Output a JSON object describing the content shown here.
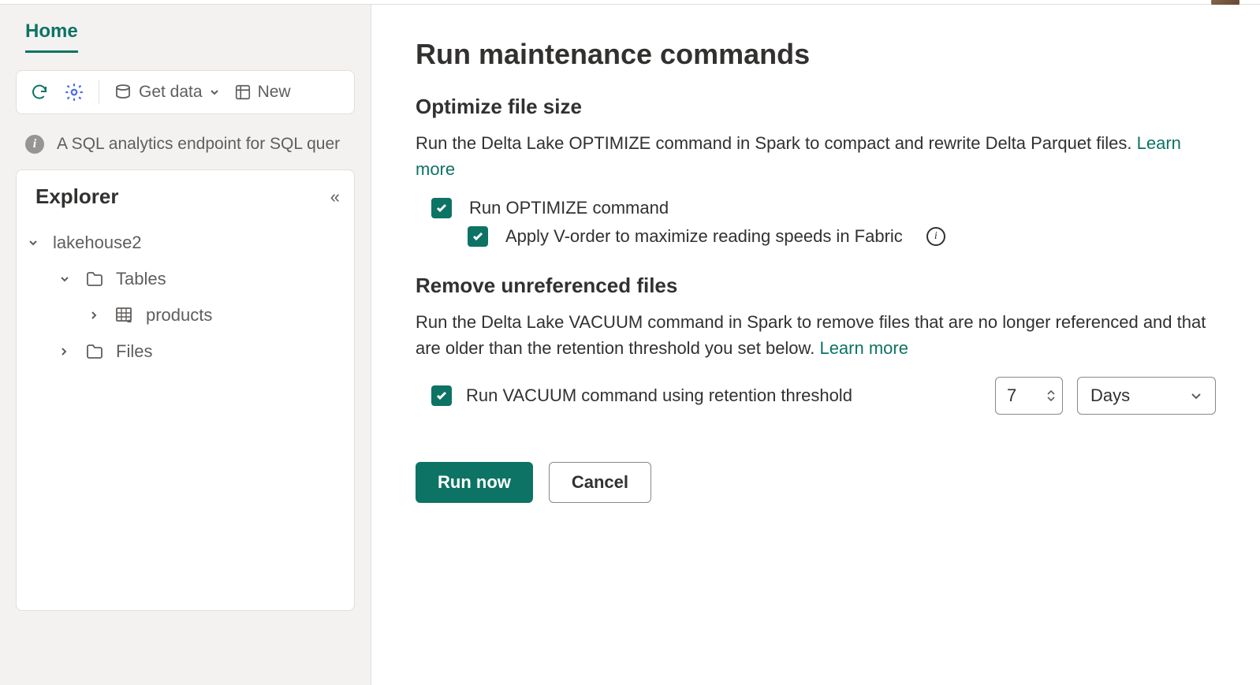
{
  "tabs": {
    "home": "Home"
  },
  "toolbar": {
    "get_data": "Get data",
    "new": "New"
  },
  "info_banner": "A SQL analytics endpoint for SQL quer",
  "explorer": {
    "title": "Explorer",
    "tree": {
      "root": "lakehouse2",
      "tables": "Tables",
      "product": "products",
      "files": "Files"
    }
  },
  "modal": {
    "title": "Run maintenance commands",
    "optimize": {
      "heading": "Optimize file size",
      "desc_pre": "Run the Delta Lake OPTIMIZE command in Spark to compact and rewrite Delta Parquet files. ",
      "learn": "Learn more",
      "chk1": "Run OPTIMIZE command",
      "chk2": "Apply V-order to maximize reading speeds in Fabric"
    },
    "vacuum": {
      "heading": "Remove unreferenced files",
      "desc_pre": "Run the Delta Lake VACUUM command in Spark to remove files that are no longer referenced and that are older than the retention threshold you set below. ",
      "learn": "Learn more",
      "chk": "Run VACUUM command using retention threshold",
      "number": "7",
      "unit": "Days"
    },
    "buttons": {
      "run": "Run now",
      "cancel": "Cancel"
    }
  }
}
